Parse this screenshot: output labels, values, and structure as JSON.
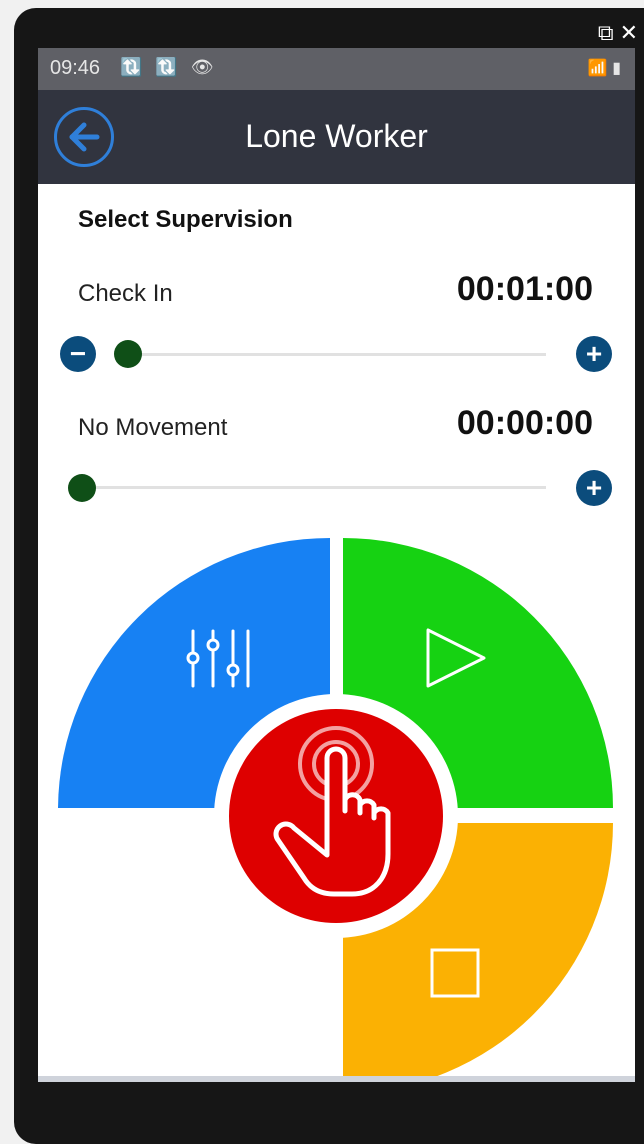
{
  "window": {
    "popout_icon": "⧉",
    "close_icon": "✕"
  },
  "status_bar": {
    "time": "09:46",
    "icons": "🔃 🔃 👁",
    "right_icons": "📶 ▮"
  },
  "app_bar": {
    "title": "Lone Worker",
    "back_icon": "back-arrow-icon"
  },
  "supervision": {
    "title": "Select Supervision",
    "check_in": {
      "label": "Check In",
      "time": "00:01:00",
      "minus": "−",
      "plus": "+"
    },
    "no_movement": {
      "label": "No Movement",
      "time": "00:00:00",
      "plus": "+"
    }
  },
  "controls": {
    "settings_color": "#1781f3",
    "play_color": "#16d212",
    "stop_color": "#fbb103",
    "panic_color": "#de0000"
  }
}
